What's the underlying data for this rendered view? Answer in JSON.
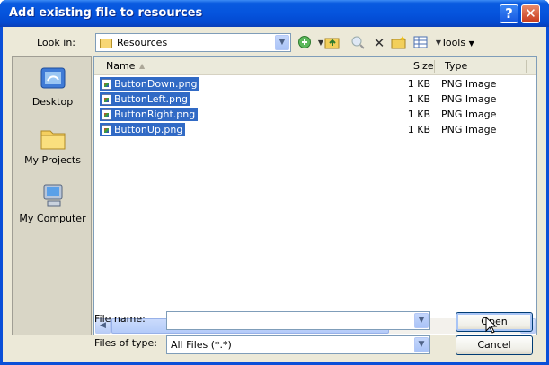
{
  "title": "Add existing file to resources",
  "titlebar": {
    "help_glyph": "?",
    "close_glyph": "✕"
  },
  "lookin": {
    "label": "Look in:",
    "value": "Resources"
  },
  "toolbar": {
    "tools_label": "Tools",
    "icons": [
      "back-icon",
      "up-folder-icon",
      "search-web-icon",
      "delete-icon",
      "new-folder-icon",
      "views-icon"
    ]
  },
  "places": [
    {
      "label": "Desktop",
      "icon": "desktop-icon"
    },
    {
      "label": "My Projects",
      "icon": "folder-icon"
    },
    {
      "label": "My Computer",
      "icon": "computer-icon"
    }
  ],
  "columns": {
    "name": "Name",
    "size": "Size",
    "type": "Type"
  },
  "files": [
    {
      "name": "ButtonDown.png",
      "size": "1 KB",
      "type": "PNG Image"
    },
    {
      "name": "ButtonLeft.png",
      "size": "1 KB",
      "type": "PNG Image"
    },
    {
      "name": "ButtonRight.png",
      "size": "1 KB",
      "type": "PNG Image"
    },
    {
      "name": "ButtonUp.png",
      "size": "1 KB",
      "type": "PNG Image"
    }
  ],
  "filename": {
    "label": "File name:",
    "value": ""
  },
  "filetype": {
    "label": "Files of type:",
    "value": "All Files (*.*)"
  },
  "buttons": {
    "open": "Open",
    "cancel": "Cancel"
  },
  "colors": {
    "selection": "#316ac5",
    "titlebar": "#0554dd",
    "dialog_bg": "#ece9d8"
  }
}
